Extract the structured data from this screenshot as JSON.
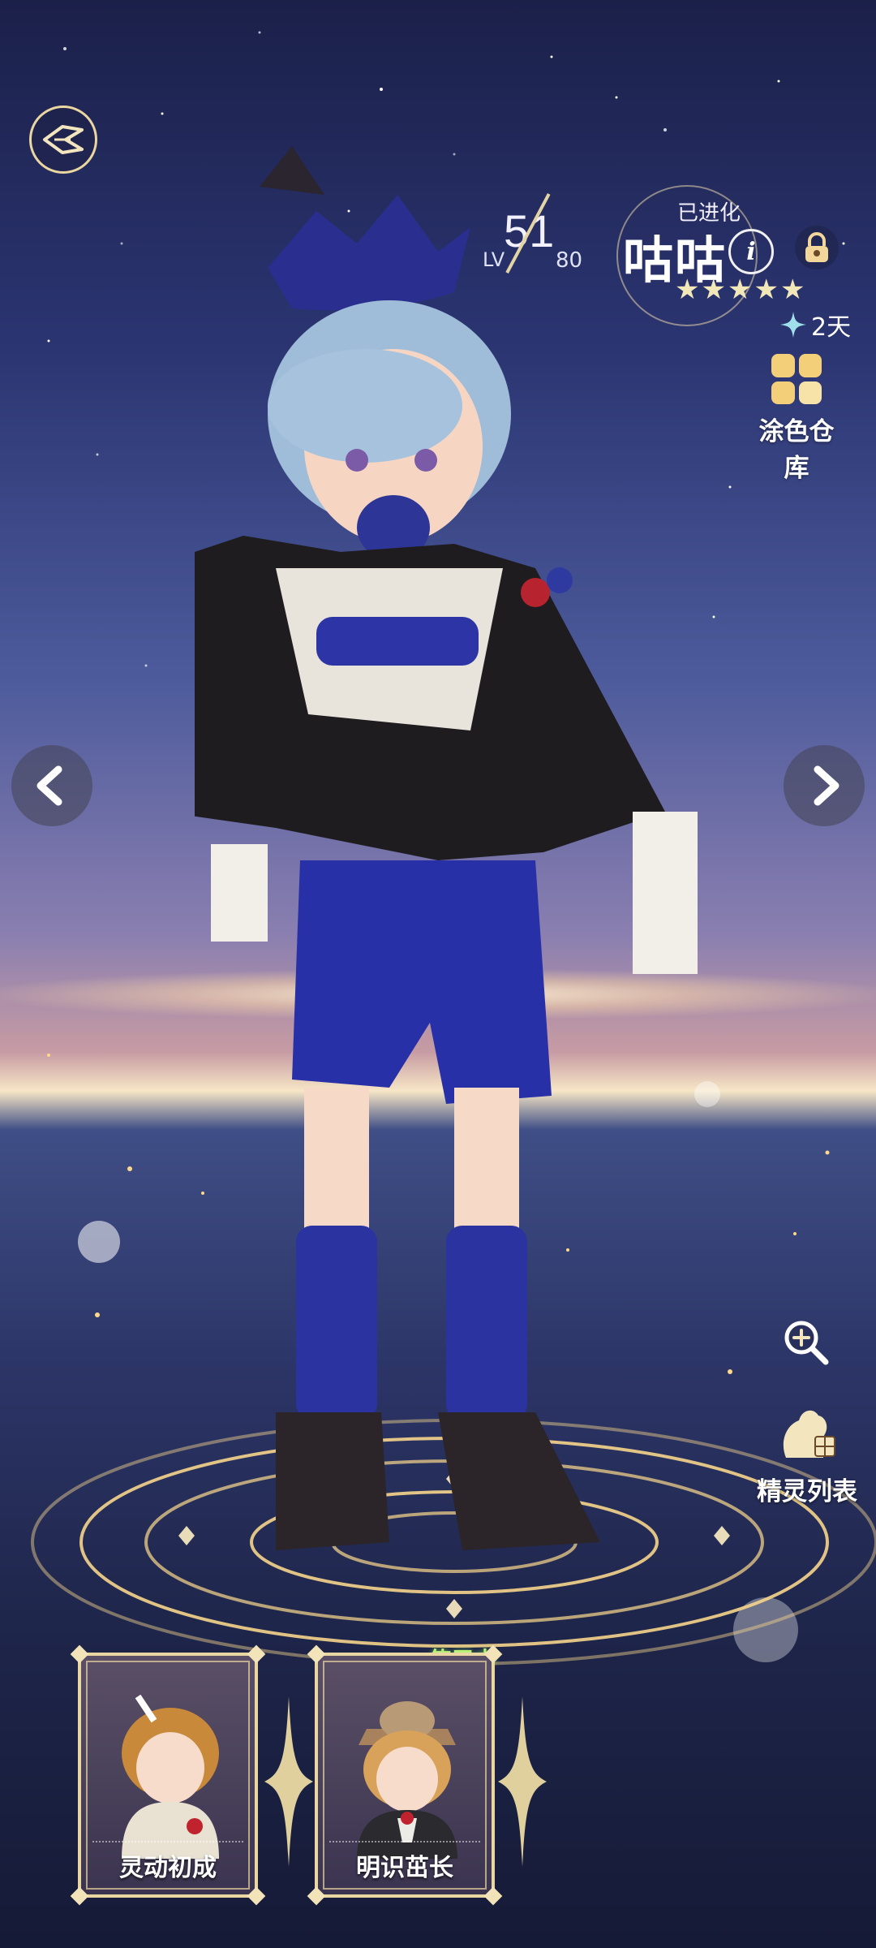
{
  "level": {
    "prefix": "LV",
    "current": "51",
    "max": "80"
  },
  "pet": {
    "status": "已进化",
    "name": "咕咕",
    "edit_icon": "i",
    "stars": 5
  },
  "timer": {
    "label": "2天"
  },
  "palette_button": {
    "label": "涂色仓库"
  },
  "pet_list_button": {
    "label": "精灵列表"
  },
  "outfits": [
    {
      "label": "灵动初成"
    },
    {
      "label": "明识茁长",
      "badge": "使用中"
    }
  ],
  "colors": {
    "accent_gold": "#e9d6a0",
    "in_use_green": "#b8f07a"
  }
}
